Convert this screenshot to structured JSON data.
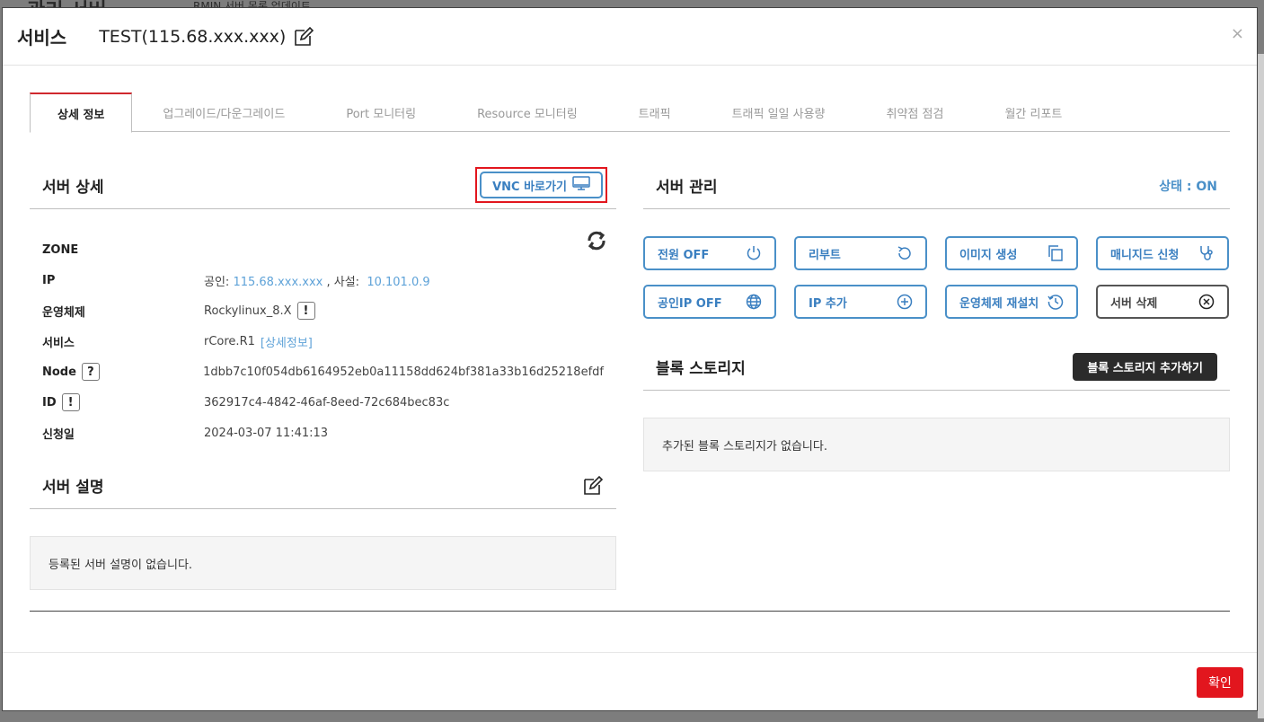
{
  "background": {
    "title_fragment": "관리 서버",
    "subtitle_fragment": "RMIN 서버 목록 업데이트"
  },
  "header": {
    "title": "서비스",
    "server_name": "TEST(115.68.xxx.xxx)",
    "close": "×"
  },
  "tabs": [
    {
      "label": "상세 정보",
      "active": true
    },
    {
      "label": "업그레이드/다운그레이드"
    },
    {
      "label": "Port 모니터링"
    },
    {
      "label": "Resource 모니터링"
    },
    {
      "label": "트래픽"
    },
    {
      "label": "트래픽 일일 사용량"
    },
    {
      "label": "취약점 점검"
    },
    {
      "label": "월간 리포트"
    }
  ],
  "server_detail": {
    "title": "서버 상세",
    "vnc_label": "VNC 바로가기",
    "rows": {
      "zone": {
        "label": "ZONE",
        "value": ""
      },
      "ip": {
        "label": "IP",
        "public_prefix": "공인: ",
        "public": "115.68.xxx.xxx",
        "private_prefix": " , 사설: ",
        "private": "10.101.0.9"
      },
      "os": {
        "label": "운영체제",
        "value": "Rockylinux_8.X",
        "badge": "!"
      },
      "service": {
        "label": "서비스",
        "value": "rCore.R1",
        "link": "[상세정보]"
      },
      "node": {
        "label": "Node",
        "badge": "?",
        "value": "1dbb7c10f054db6164952eb0a11158dd624bf381a33b16d25218efdf"
      },
      "id": {
        "label": "ID",
        "badge": "!",
        "value": "362917c4-4842-46af-8eed-72c684bec83c"
      },
      "date": {
        "label": "신청일",
        "value": "2024-03-07 11:41:13"
      }
    }
  },
  "server_desc": {
    "title": "서버 설명",
    "empty": "등록된 서버 설명이 없습니다."
  },
  "server_manage": {
    "title": "서버 관리",
    "status": "상태 : ON",
    "buttons": {
      "power": "전원 OFF",
      "reboot": "리부트",
      "image": "이미지 생성",
      "managed": "매니지드 신청",
      "public_ip": "공인IP OFF",
      "add_ip": "IP 추가",
      "reinstall": "운영체제 재설치",
      "delete": "서버 삭제"
    }
  },
  "block_storage": {
    "title": "블록 스토리지",
    "add_label": "블록 스토리지 추가하기",
    "empty": "추가된 블록 스토리지가 없습니다."
  },
  "footer": {
    "ok": "확인"
  },
  "colors": {
    "accent": "#4a90c8",
    "danger": "#e2161e"
  }
}
